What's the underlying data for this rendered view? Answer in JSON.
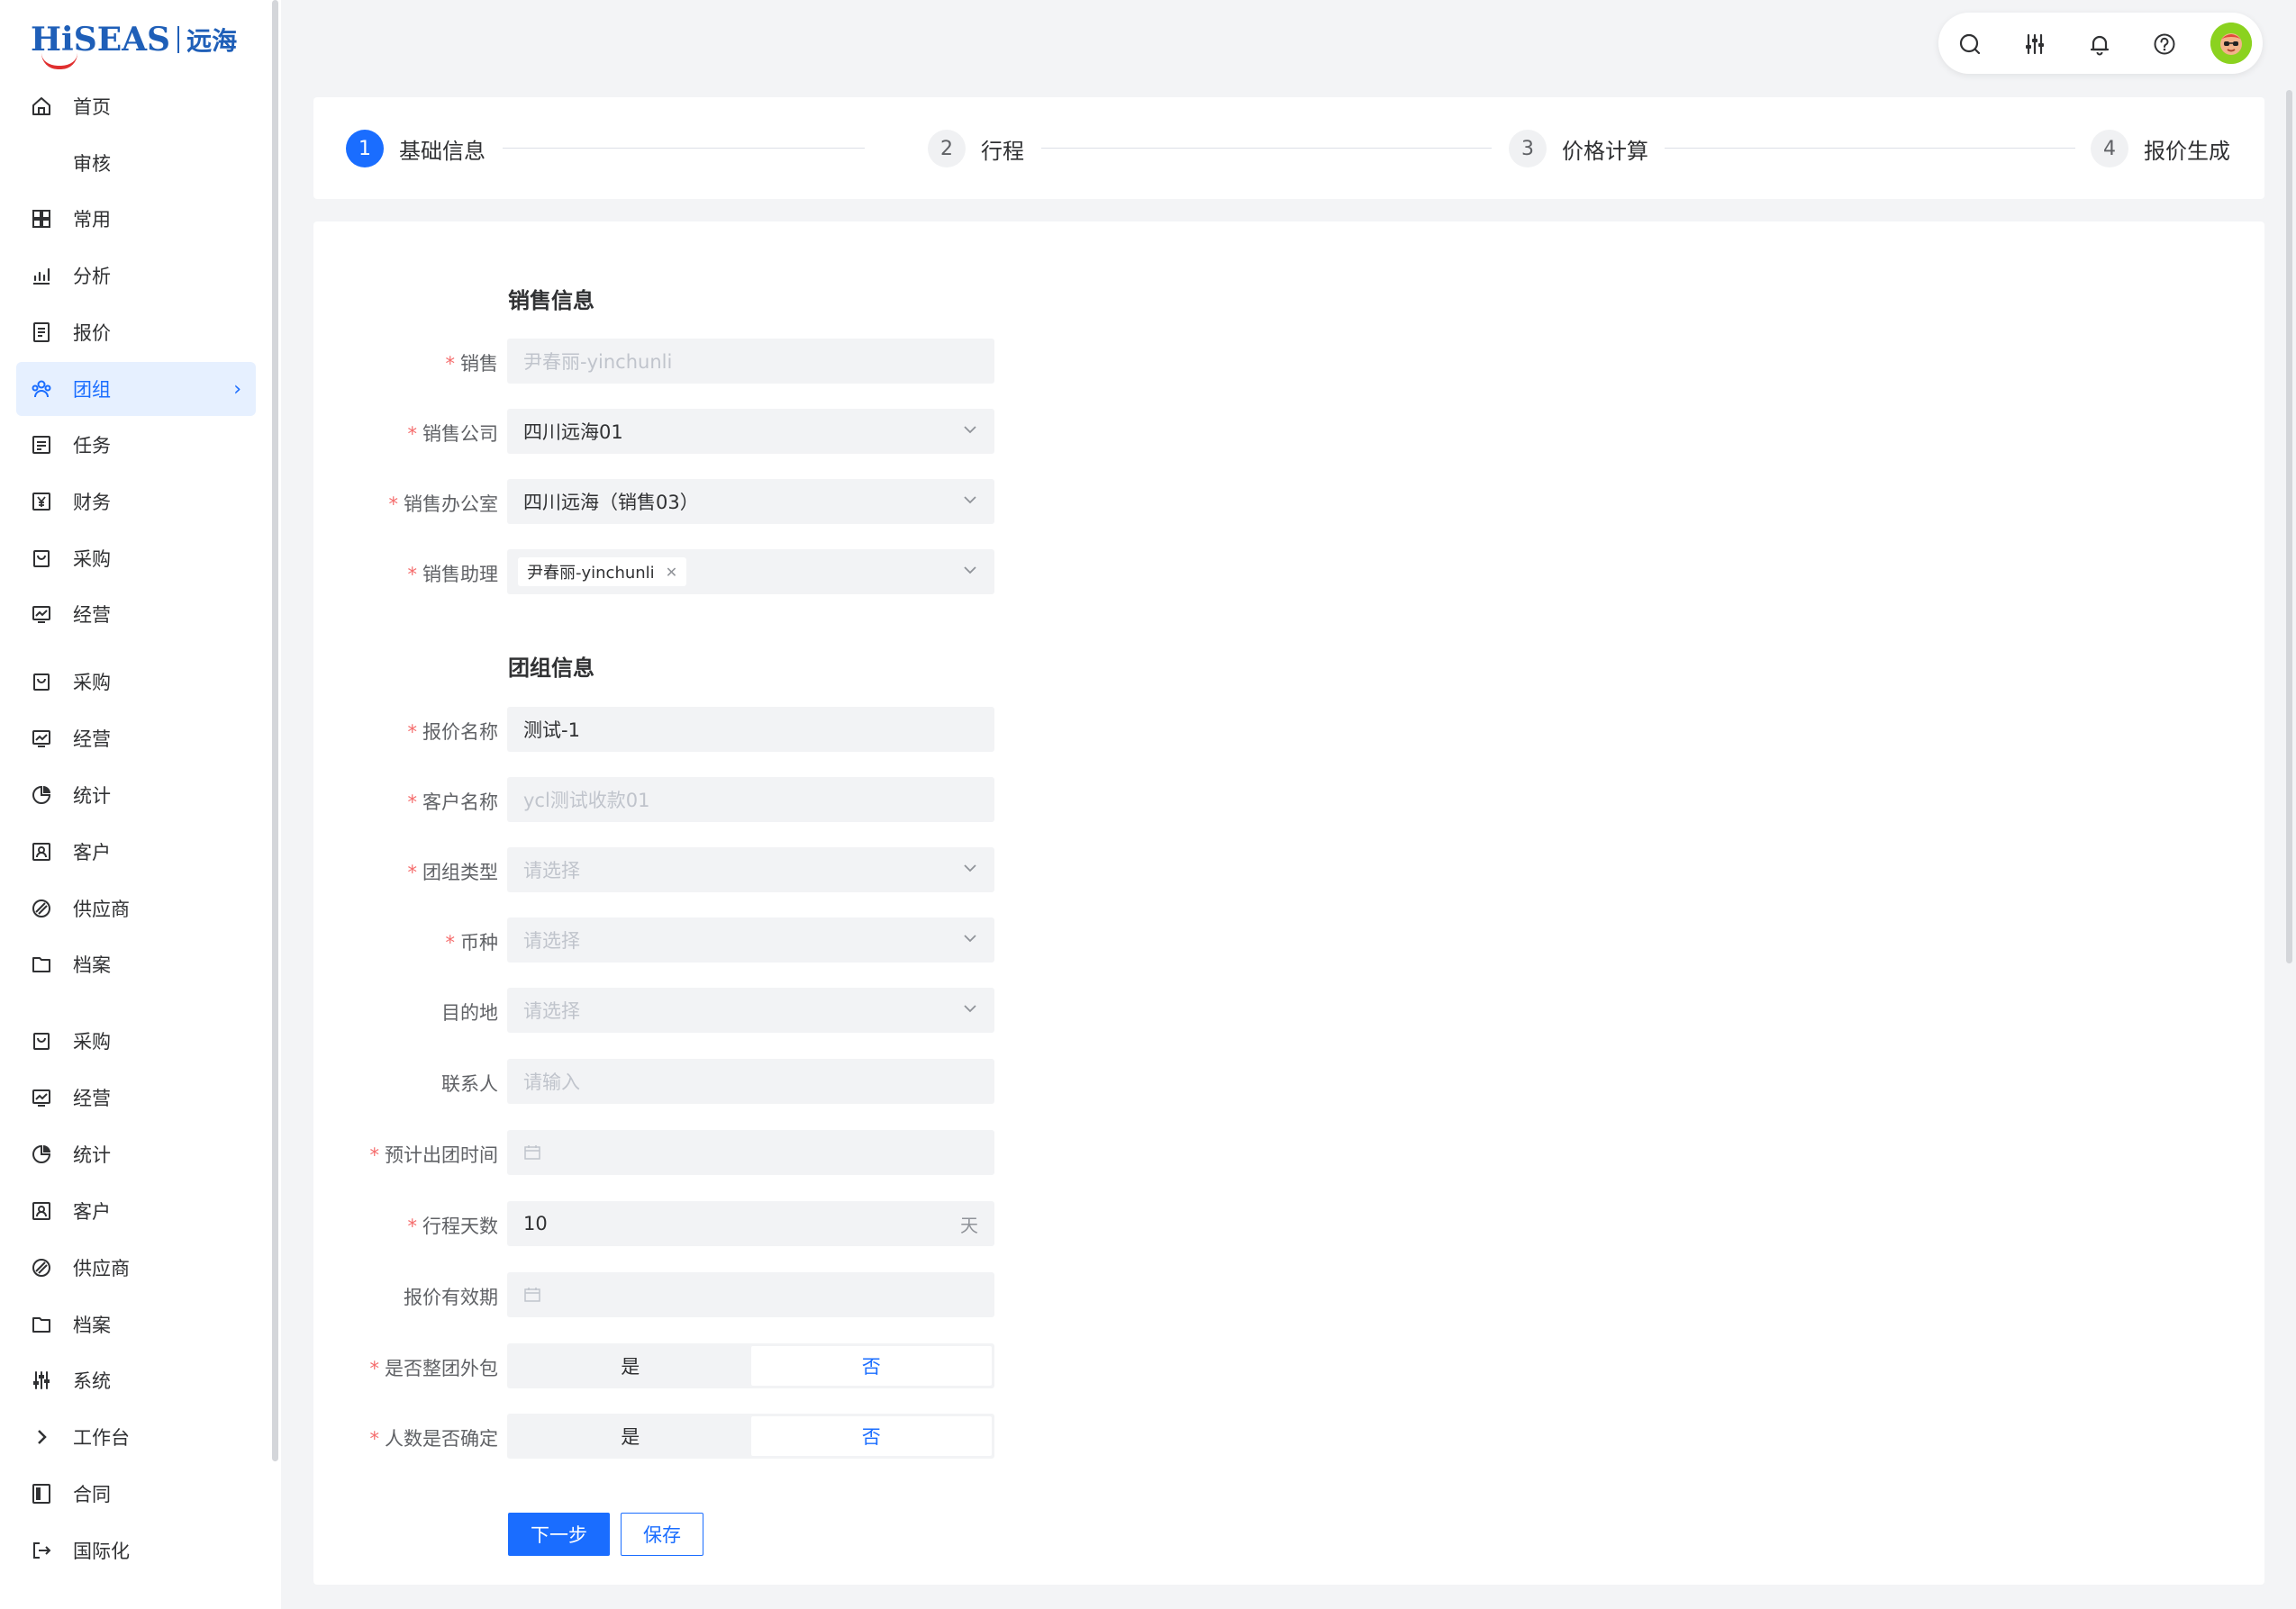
{
  "brand": {
    "en": "HiSEAS",
    "cn": "远海",
    "accent": "#1a6dff"
  },
  "sidebar": {
    "items": [
      {
        "label": "首页",
        "icon": "home-icon"
      },
      {
        "label": "审核",
        "icon": ""
      },
      {
        "label": "常用",
        "icon": "grid-icon"
      },
      {
        "label": "分析",
        "icon": "chart-icon"
      },
      {
        "label": "报价",
        "icon": "document-icon"
      },
      {
        "label": "团组",
        "icon": "group-icon",
        "active": true
      },
      {
        "label": "任务",
        "icon": "task-icon"
      },
      {
        "label": "财务",
        "icon": "yen-icon"
      },
      {
        "label": "采购",
        "icon": "bag-icon"
      },
      {
        "label": "经营",
        "icon": "monitor-icon"
      },
      {
        "label": "采购",
        "icon": "bag-icon"
      },
      {
        "label": "经营",
        "icon": "monitor-icon"
      },
      {
        "label": "统计",
        "icon": "pie-icon"
      },
      {
        "label": "客户",
        "icon": "contact-icon"
      },
      {
        "label": "供应商",
        "icon": "supplier-icon"
      },
      {
        "label": "档案",
        "icon": "folder-icon"
      },
      {
        "label": "采购",
        "icon": "bag-icon"
      },
      {
        "label": "经营",
        "icon": "monitor-icon"
      },
      {
        "label": "统计",
        "icon": "pie-icon"
      },
      {
        "label": "客户",
        "icon": "contact-icon"
      },
      {
        "label": "供应商",
        "icon": "supplier-icon"
      },
      {
        "label": "档案",
        "icon": "folder-icon"
      },
      {
        "label": "系统",
        "icon": "sliders-icon"
      },
      {
        "label": "工作台",
        "icon": "chevron-right-icon"
      },
      {
        "label": "合同",
        "icon": "contract-icon"
      },
      {
        "label": "国际化",
        "icon": "exit-icon"
      }
    ]
  },
  "topbar": {
    "icons": [
      "search-icon",
      "sliders-icon",
      "bell-icon",
      "help-icon",
      "avatar"
    ]
  },
  "steps": [
    {
      "num": "1",
      "label": "基础信息"
    },
    {
      "num": "2",
      "label": "行程"
    },
    {
      "num": "3",
      "label": "价格计算"
    },
    {
      "num": "4",
      "label": "报价生成"
    }
  ],
  "form": {
    "sales_section": "销售信息",
    "group_section": "团组信息",
    "sales": {
      "label": "销售",
      "value": "尹春丽-yinchunli"
    },
    "sales_company": {
      "label": "销售公司",
      "value": "四川远海01"
    },
    "sales_office": {
      "label": "销售办公室",
      "value": "四川远海（销售03）"
    },
    "sales_assistant": {
      "label": "销售助理",
      "tag": "尹春丽-yinchunli"
    },
    "quote_name": {
      "label": "报价名称",
      "value": "测试-1"
    },
    "customer_name": {
      "label": "客户名称",
      "value": "ycl测试收款01"
    },
    "group_type": {
      "label": "团组类型",
      "placeholder": "请选择"
    },
    "currency": {
      "label": "币种",
      "placeholder": "请选择"
    },
    "destination": {
      "label": "目的地",
      "placeholder": "请选择"
    },
    "contact": {
      "label": "联系人",
      "placeholder": "请输入"
    },
    "departure_date": {
      "label": "预计出团时间"
    },
    "trip_days": {
      "label": "行程天数",
      "value": "10",
      "suffix": "天"
    },
    "quote_valid": {
      "label": "报价有效期"
    },
    "outsource": {
      "label": "是否整团外包",
      "yes": "是",
      "no": "否",
      "selected": "no"
    },
    "headcount_fixed": {
      "label": "人数是否确定",
      "yes": "是",
      "no": "否",
      "selected": "no"
    },
    "next_button": "下一步",
    "save_button": "保存"
  }
}
